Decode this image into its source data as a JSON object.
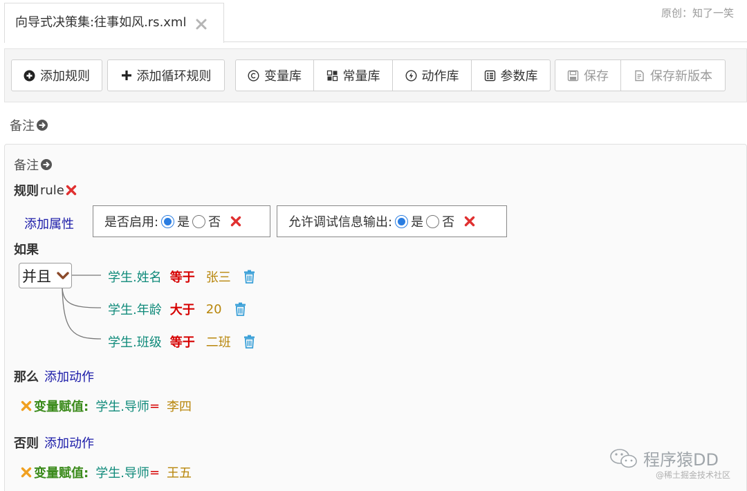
{
  "tab": {
    "title": "向导式决策集:往事如风.rs.xml"
  },
  "author": "原创：知了一笑",
  "toolbar": {
    "add_rule": "添加规则",
    "add_loop_rule": "添加循环规则",
    "variable_lib": "变量库",
    "constant_lib": "常量库",
    "action_lib": "动作库",
    "parameter_lib": "参数库",
    "save": "保存",
    "save_new_version": "保存新版本"
  },
  "note_label": "备注",
  "rule": {
    "prefix": "规则",
    "name": "rule",
    "add_property": "添加属性",
    "enabled": {
      "label": "是否启用:",
      "yes": "是",
      "no": "否"
    },
    "debug_output": {
      "label": "允许调试信息输出:",
      "yes": "是",
      "no": "否"
    }
  },
  "if_label": "如果",
  "logic_operator": "并且",
  "conditions": [
    {
      "variable": "学生.姓名",
      "operator": "等于",
      "value": "张三"
    },
    {
      "variable": "学生.年龄",
      "operator": "大于",
      "value": "20"
    },
    {
      "variable": "学生.班级",
      "operator": "等于",
      "value": "二班"
    }
  ],
  "then": {
    "label": "那么",
    "add_action": "添加动作",
    "action": {
      "type": "变量赋值:",
      "variable": "学生.导师",
      "eq": "=",
      "value": "李四"
    }
  },
  "else": {
    "label": "否则",
    "add_action": "添加动作",
    "action": {
      "type": "变量赋值:",
      "variable": "学生.导师",
      "eq": "=",
      "value": "王五"
    }
  },
  "watermark": {
    "name": "程序猿DD",
    "sub": "@稀土掘金技术社区"
  },
  "colors": {
    "variable": "#0f8a7a",
    "operator": "#d60000",
    "value": "#b8860b",
    "link": "#1a1aa8",
    "trash": "#3aa0d8",
    "delete_red": "#e03030",
    "delete_orange": "#f0a020",
    "radio": "#2a7de1"
  }
}
